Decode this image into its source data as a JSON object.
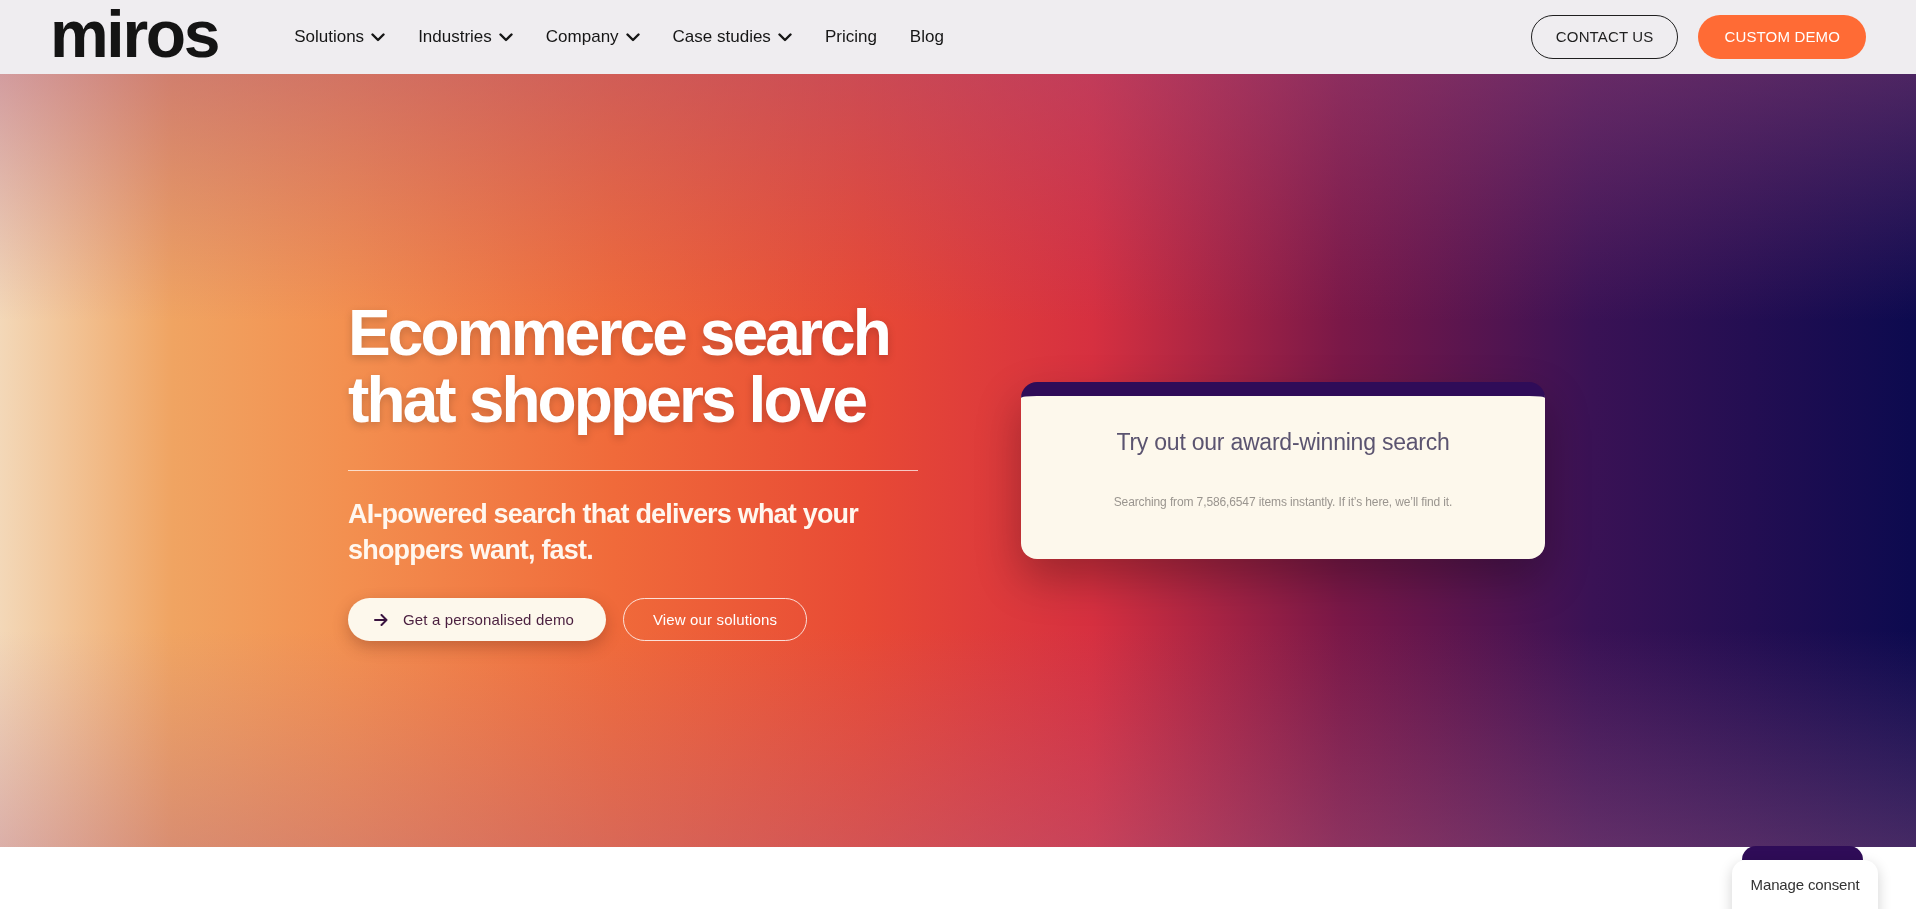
{
  "header": {
    "logo": "miros",
    "nav": [
      {
        "label": "Solutions",
        "has_dropdown": true
      },
      {
        "label": "Industries",
        "has_dropdown": true
      },
      {
        "label": "Company",
        "has_dropdown": true
      },
      {
        "label": "Case studies",
        "has_dropdown": true
      },
      {
        "label": "Pricing",
        "has_dropdown": false
      },
      {
        "label": "Blog",
        "has_dropdown": false
      }
    ],
    "buttons": [
      {
        "label": "CONTACT US",
        "kind": "outline"
      },
      {
        "label": "CUSTOM DEMO",
        "kind": "filled"
      }
    ]
  },
  "hero": {
    "headline": "Ecommerce search that shoppers love",
    "subheading": "AI-powered search that delivers what your shoppers want, fast.",
    "buttons": [
      {
        "label": "Get a personalised demo",
        "kind": "primary"
      },
      {
        "label": "View our solutions",
        "kind": "outline"
      }
    ]
  },
  "search_card": {
    "title": "Try out our award-winning search",
    "subtitle": "Searching from 7,586,6547 items instantly. If it’s here, we’ll find it."
  },
  "consent_button": {
    "label": "Manage consent"
  }
}
